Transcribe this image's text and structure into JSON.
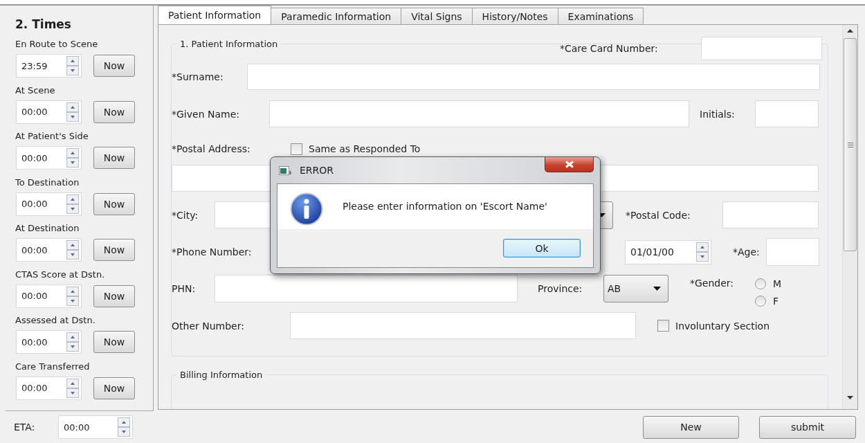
{
  "times": {
    "title": "2. Times",
    "entries": [
      {
        "label": "En Route to Scene",
        "value": "23:59",
        "button": "Now"
      },
      {
        "label": "At Scene",
        "value": "00:00",
        "button": "Now"
      },
      {
        "label": "At Patient's Side",
        "value": "00:00",
        "button": "Now"
      },
      {
        "label": "To Destination",
        "value": "00:00",
        "button": "Now"
      },
      {
        "label": "At Destination",
        "value": "00:00",
        "button": "Now"
      },
      {
        "label": "CTAS Score at Dstn.",
        "value": "00:00",
        "button": "Now"
      },
      {
        "label": "Assessed at Dstn.",
        "value": "00:00",
        "button": "Now"
      },
      {
        "label": "Care Transferred",
        "value": "00:00",
        "button": "Now"
      }
    ]
  },
  "tabs": [
    {
      "label": "Patient Information",
      "selected": true
    },
    {
      "label": "Paramedic Information",
      "selected": false
    },
    {
      "label": "Vital Signs",
      "selected": false
    },
    {
      "label": "History/Notes",
      "selected": false
    },
    {
      "label": "Examinations",
      "selected": false
    }
  ],
  "patient_information": {
    "title": "1. Patient Information",
    "care_card_number": {
      "label": "*Care Card Number:"
    },
    "surname": {
      "label": "*Surname:"
    },
    "given_name": {
      "label": "*Given Name:"
    },
    "initials": {
      "label": "Initials:"
    },
    "postal_address": {
      "label": "*Postal Address:"
    },
    "same_as_responded_to": {
      "label": "Same as Responded To",
      "checked": false
    },
    "city": {
      "label": "*City:"
    },
    "postal_code": {
      "label": "*Postal Code:"
    },
    "phone_number": {
      "label": "*Phone Number:"
    },
    "date": {
      "value": "01/01/00"
    },
    "age": {
      "label": "*Age:"
    },
    "phn": {
      "label": "PHN:"
    },
    "province": {
      "label": "Province:",
      "value": "AB"
    },
    "gender": {
      "label": "*Gender:",
      "options": [
        {
          "label": "M",
          "selected": false
        },
        {
          "label": "F",
          "selected": false
        }
      ]
    },
    "other_number": {
      "label": "Other Number:"
    },
    "involuntary_section": {
      "label": "Involuntary Section",
      "checked": false
    }
  },
  "billing_information": {
    "title": "Billing Information"
  },
  "eta": {
    "label": "ETA:",
    "value": "00:00"
  },
  "buttons": [
    "New",
    "submit"
  ],
  "dialog": {
    "title": "ERROR",
    "message": "Please enter information on 'Escort Name'",
    "button": "Ok"
  }
}
